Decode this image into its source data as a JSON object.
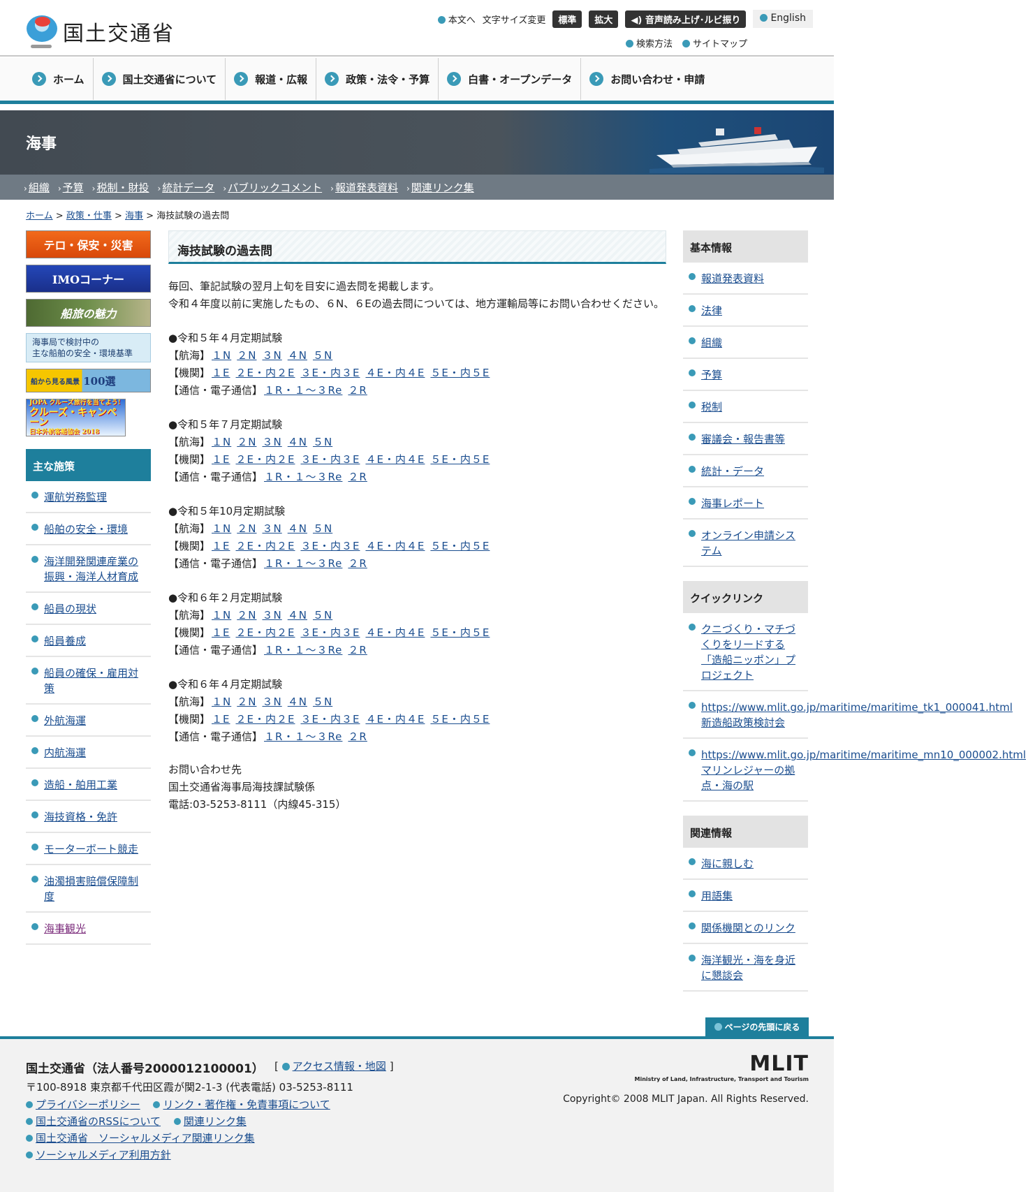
{
  "header": {
    "logo_text": "国土交通省",
    "skip_link": "本文へ",
    "font_size_label": "文字サイズ変更",
    "font_standard": "標準",
    "font_large": "拡大",
    "voice_button": "音声読み上げ･ルビ振り",
    "english": "English",
    "search_method": "検索方法",
    "sitemap": "サイトマップ"
  },
  "gnav": [
    "ホーム",
    "国土交通省について",
    "報道・広報",
    "政策・法令・予算",
    "白書・オープンデータ",
    "お問い合わせ・申請"
  ],
  "banner": {
    "title": "海事"
  },
  "subnav": [
    "組織",
    "予算",
    "税制・財投",
    "統計データ",
    "パブリックコメント",
    "報道発表資料",
    "関連リンク集"
  ],
  "breadcrumb": {
    "home": "ホーム",
    "policy": "政策・仕事",
    "maritime": "海事",
    "current": "海技試験の過去問",
    "sep": ">"
  },
  "left_banners": {
    "terror": "テロ・保安・災害",
    "imo": "IMOコーナー",
    "funatabi": "船旅の魅力",
    "kentou_1": "海事局で検討中の",
    "kentou_2": "主な船舶の安全・環境基準",
    "fune100_1": "船から見る風景",
    "fune100_2": "100選",
    "jopa_1": "JOPA クルーズ旅行を当てよう!",
    "jopa_2": "クルーズ・キャンペーン",
    "jopa_3": "日本外航客船協会 2018"
  },
  "left_nav": {
    "heading": "主な施策",
    "items": [
      "運航労務監理",
      "船舶の安全・環境",
      "海洋開発関連産業の振興・海洋人材育成",
      "船員の現状",
      "船員養成",
      "船員の確保・雇用対策",
      "外航海運",
      "内航海運",
      "造船・舶用工業",
      "海技資格・免許",
      "モーターボート競走",
      "油濁損害賠償保障制度",
      "海事観光"
    ]
  },
  "main": {
    "title": "海技試験の過去問",
    "intro_1": "毎回、筆記試験の翌月上旬を目安に過去問を掲載します。",
    "intro_2": "令和４年度以前に実施したもの、６N、６Eの過去問については、地方運輸局等にお問い合わせください。",
    "label_nav": "【航海】",
    "label_eng": "【機関】",
    "label_com": "【通信・電子通信】",
    "exams": [
      {
        "title": "●令和５年４月定期試験",
        "nav": [
          "１N",
          "２N",
          "３N",
          "４N",
          "５N"
        ],
        "eng": [
          "１E",
          "２E・内２E",
          "３E・内３E",
          "４E・内４E",
          "５E・内５E"
        ],
        "com": [
          "１R・１～３Re",
          "２R"
        ]
      },
      {
        "title": "●令和５年７月定期試験",
        "nav": [
          "１N",
          "２N",
          "３N",
          "４N",
          "５N"
        ],
        "eng": [
          "１E",
          "２E・内２E",
          "３E・内３E",
          "４E・内４E",
          "５E・内５E"
        ],
        "com": [
          "１R・１～３Re",
          "２R"
        ]
      },
      {
        "title": "●令和５年10月定期試験",
        "nav": [
          "１N",
          "２N",
          "３N",
          "４N",
          "５N"
        ],
        "eng": [
          "１E",
          "２E・内２E",
          "３E・内３E",
          "４E・内４E",
          "５E・内５E"
        ],
        "com": [
          "１R・１～３Re",
          "２R"
        ]
      },
      {
        "title": "●令和６年２月定期試験",
        "nav": [
          "１N",
          "２N",
          "３N",
          "４N",
          "５N"
        ],
        "eng": [
          "１E",
          "２E・内２E",
          "３E・内３E",
          "４E・内４E",
          "５E・内５E"
        ],
        "com": [
          "１R・１～３Re",
          "２R"
        ]
      },
      {
        "title": "●令和６年４月定期試験",
        "nav": [
          "１N",
          "２N",
          "３N",
          "４N",
          "５N"
        ],
        "eng": [
          "１E",
          "２E・内２E",
          "３E・内３E",
          "４E・内４E",
          "５E・内５E"
        ],
        "com": [
          "１R・１～３Re",
          "２R"
        ]
      }
    ],
    "contact_1": "お問い合わせ先",
    "contact_2": "国土交通省海事局海技課試験係",
    "contact_3": "電話:03-5253-8111（内線45-315）"
  },
  "right_nav": {
    "basic_heading": "基本情報",
    "basic_items": [
      "報道発表資料",
      "法律",
      "組織",
      "予算",
      "税制",
      "審議会・報告書等",
      "統計・データ",
      "海事レポート",
      "オンライン申請システム"
    ],
    "quick_heading": "クイックリンク",
    "quick_1": "クニづくり・マチづくりをリードする「造船ニッポン」プロジェクト",
    "quick_2_url": "https://www.mlit.go.jp/maritime/maritime_tk1_000041.html",
    "quick_2_label": "新造船政策検討会",
    "quick_3_url": "https://www.mlit.go.jp/maritime/maritime_mn10_000002.html",
    "quick_3_label": "マリンレジャーの拠点・海の駅",
    "related_heading": "関連情報",
    "related_items": [
      "海に親しむ",
      "用語集",
      "関係機関とのリンク",
      "海洋観光・海を身近に懇談会"
    ]
  },
  "footer": {
    "to_top": "ページの先頭に戻る",
    "org_name": "国土交通省（法人番号2000012100001）",
    "access_open": "[",
    "access": "アクセス情報・地図",
    "access_close": "]",
    "address": "〒100-8918 東京都千代田区霞が関2-1-3 (代表電話) 03-5253-8111",
    "links": [
      "プライバシーポリシー",
      "リンク・著作権・免責事項について",
      "国土交通省のRSSについて",
      "関連リンク集",
      "国土交通省　ソーシャルメディア関連リンク集",
      "ソーシャルメディア利用方針"
    ],
    "mlit_logo": "MLIT",
    "mlit_sub": "Ministry of Land, Infrastructure, Transport and Tourism",
    "copyright": "Copyright© 2008 MLIT Japan. All Rights Reserved."
  },
  "colors": {
    "accent": "#1e7f9c",
    "link": "#1a4d8f",
    "banner": "#424a52",
    "subnav": "#6f7a84"
  }
}
